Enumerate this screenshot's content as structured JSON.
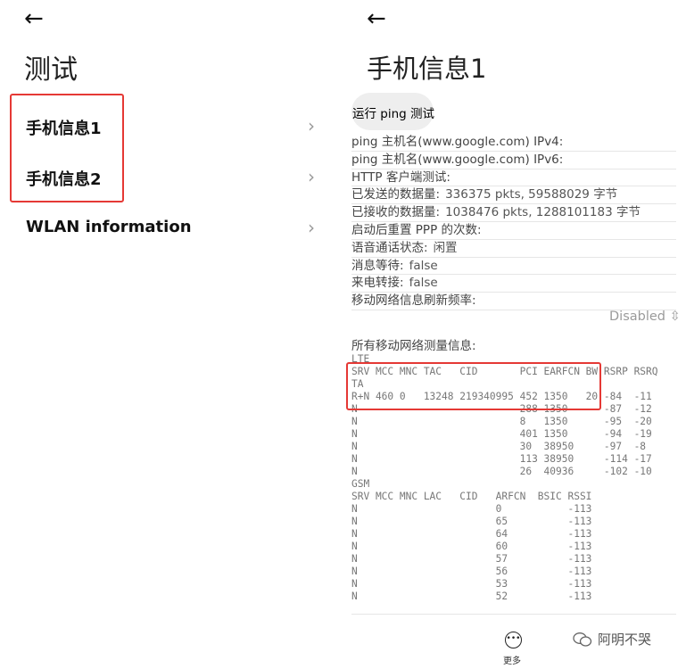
{
  "left": {
    "back_icon": "←",
    "title": "测试",
    "items": [
      {
        "label": "手机信息1"
      },
      {
        "label": "手机信息2"
      },
      {
        "label": "WLAN information"
      }
    ],
    "chevron": "›"
  },
  "right": {
    "back_icon": "←",
    "title": "手机信息1",
    "ping_button": "运行 ping 测试",
    "rows": [
      {
        "label": "ping 主机名(www.google.com) IPv4:",
        "value": ""
      },
      {
        "label": "ping 主机名(www.google.com) IPv6:",
        "value": ""
      },
      {
        "label": "HTTP 客户端测试:",
        "value": ""
      },
      {
        "label": "已发送的数据量:",
        "value": "336375 pkts, 59588029 字节"
      },
      {
        "label": "已接收的数据量:",
        "value": "1038476 pkts, 1288101183 字节"
      },
      {
        "label": "启动后重置 PPP 的次数:",
        "value": ""
      },
      {
        "label": "语音通话状态:",
        "value": "闲置"
      },
      {
        "label": "消息等待:",
        "value": "false"
      },
      {
        "label": "来电转接:",
        "value": "false"
      },
      {
        "label": "移动网络信息刷新频率:",
        "value": ""
      }
    ],
    "refresh_select": "Disabled",
    "measure_title": "所有移动网络测量信息:",
    "lte_table": "LTE\nSRV MCC MNC TAC   CID       PCI EARFCN BW RSRP RSRQ\nTA\nR+N 460 0   13248 219340995 452 1350   20 -84  -11\nN                           288 1350      -87  -12\nN                           8   1350      -95  -20\nN                           401 1350      -94  -19\nN                           30  38950     -97  -8\nN                           113 38950     -114 -17\nN                           26  40936     -102 -10",
    "gsm_table": "GSM\nSRV MCC MNC LAC   CID   ARFCN  BSIC RSSI\nN                       0           -113\nN                       65          -113\nN                       64          -113\nN                       60          -113\nN                       57          -113\nN                       56          -113\nN                       53          -113\nN                       52          -113",
    "more_label": "更多"
  },
  "watermark": "阿明不哭"
}
